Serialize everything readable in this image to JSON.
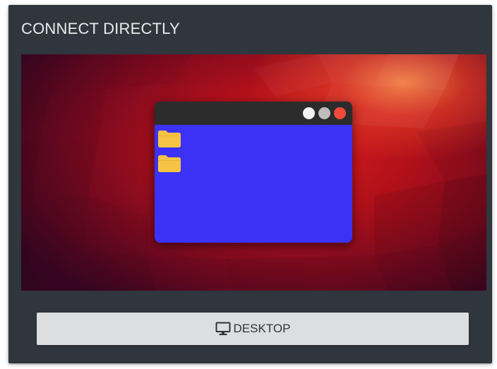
{
  "card": {
    "title": "CONNECT DIRECTLY"
  },
  "preview": {
    "description_icon": "desktop-window-illustration",
    "window_buttons": [
      "white",
      "gray",
      "red"
    ],
    "folders": 2,
    "colors": {
      "window_body": "#3b32f5",
      "titlebar": "#2c2c2c",
      "folder": "#f6c445",
      "btn_white": "#f2f2f2",
      "btn_gray": "#bdbdbd",
      "btn_red": "#f2493a"
    }
  },
  "action": {
    "desktop_label": "DESKTOP",
    "desktop_icon": "monitor-icon"
  }
}
